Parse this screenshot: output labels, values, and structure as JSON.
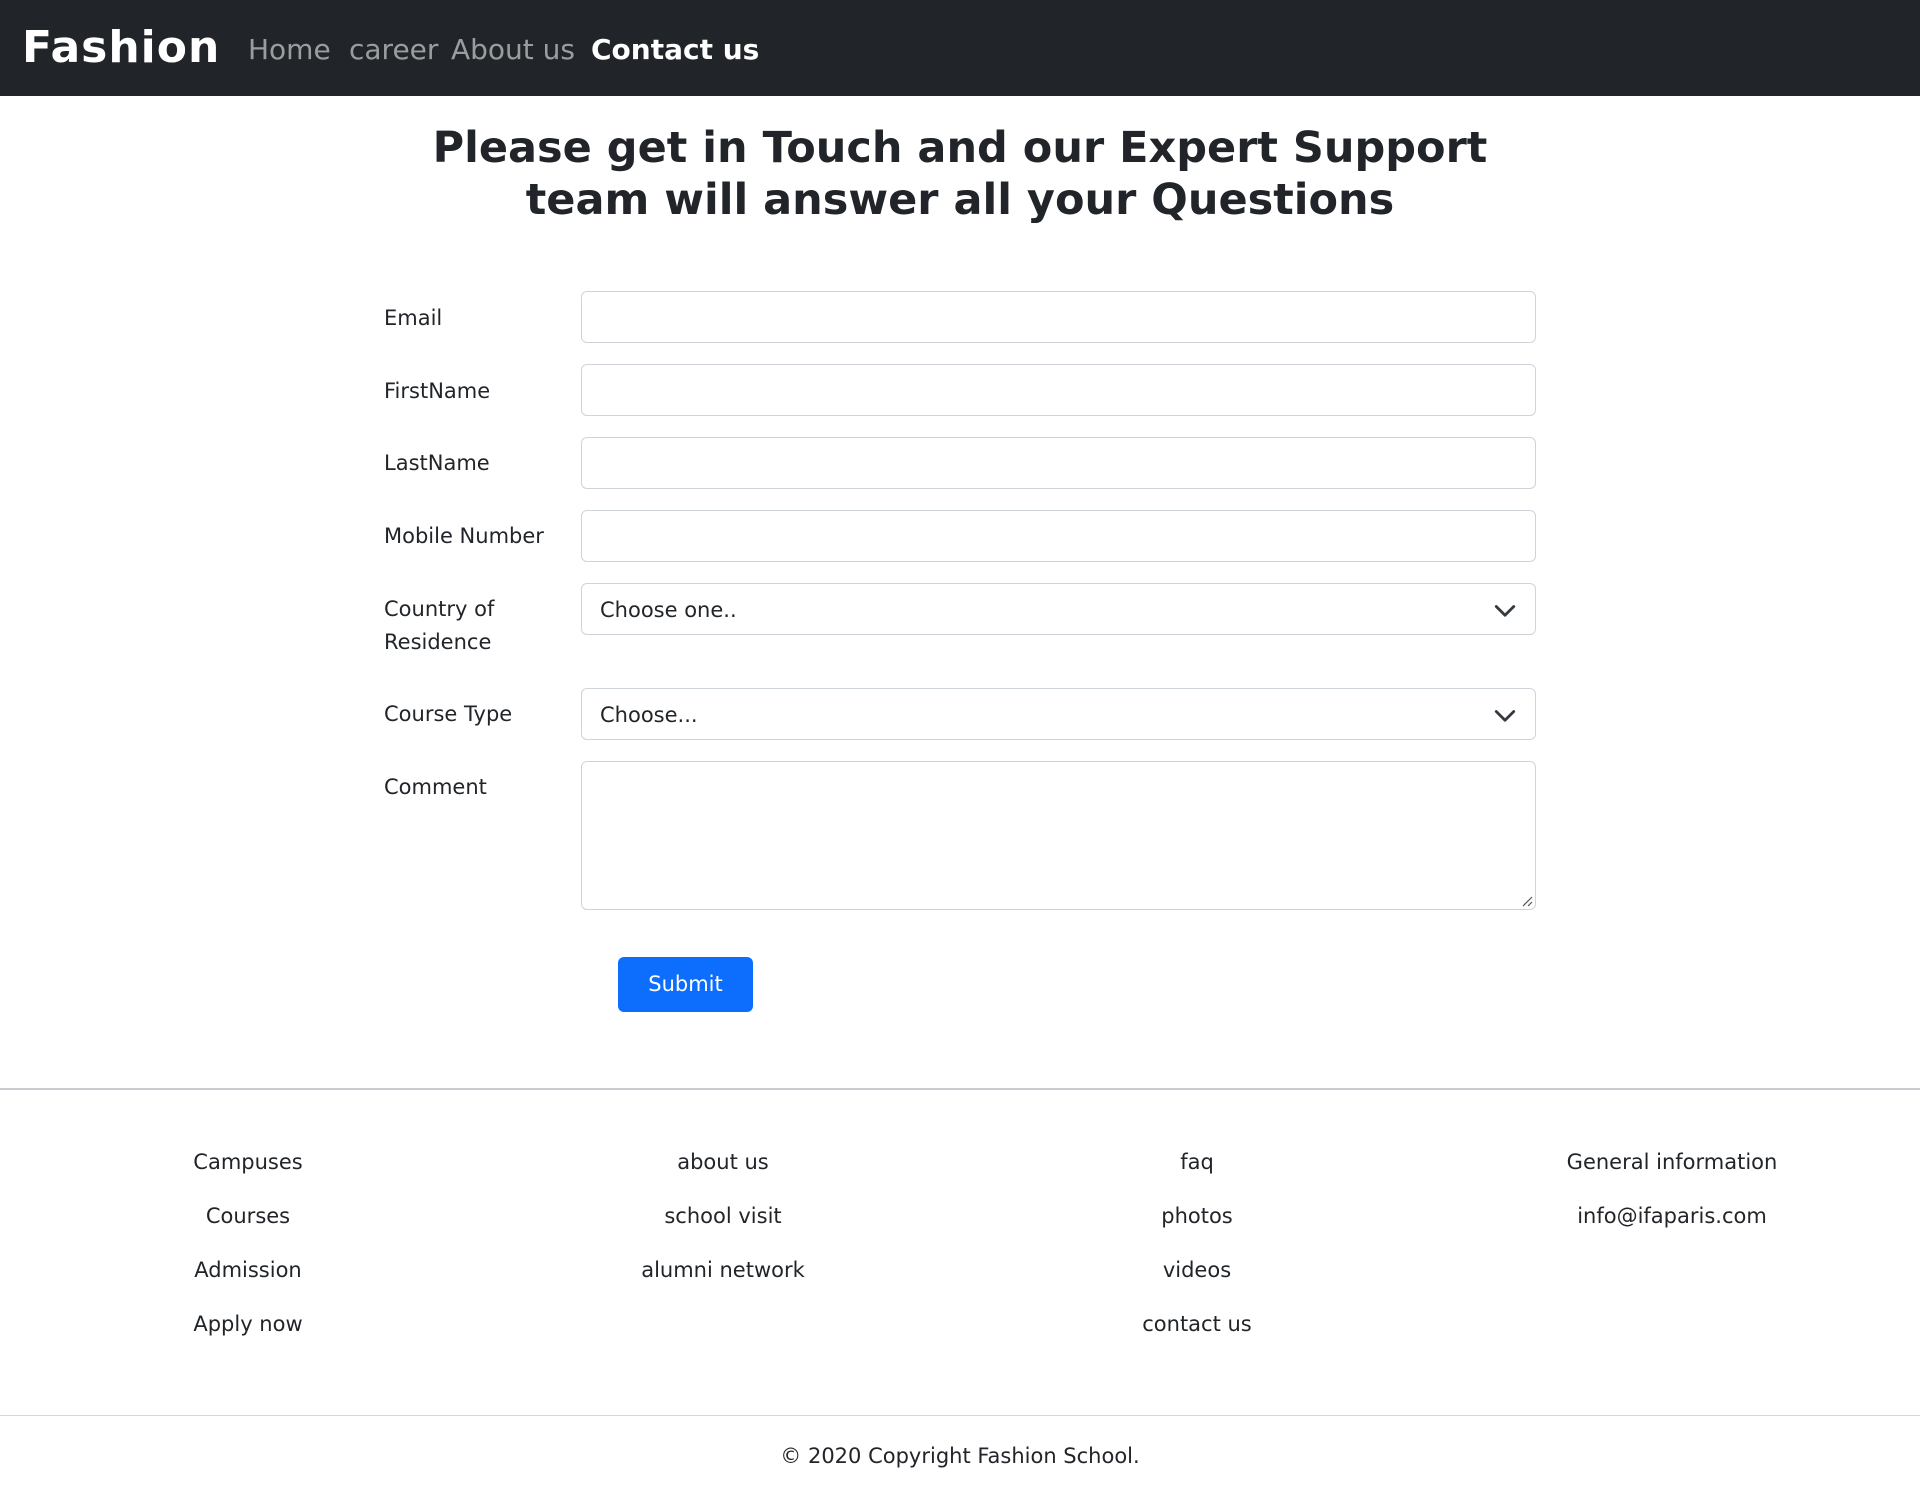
{
  "navbar": {
    "brand": "Fashion",
    "links": [
      "Home",
      "career",
      "About us",
      "Contact us"
    ],
    "active": "Contact us"
  },
  "heading": {
    "line1": "Please get in Touch and our Expert Support",
    "line2": "team will answer all your Questions"
  },
  "form": {
    "email_label": "Email",
    "firstname_label": "FirstName",
    "lastname_label": "LastName",
    "mobile_label": "Mobile Number",
    "country_label_1": "Country of",
    "country_label_2": "Residence",
    "country_value": "Choose one..",
    "course_label": "Course Type",
    "course_value": "Choose...",
    "comment_label": "Comment",
    "submit_label": "Submit"
  },
  "footer": {
    "col1": [
      "Campuses",
      "Courses",
      "Admission",
      "Apply now"
    ],
    "col2": [
      "about us",
      "school visit",
      "alumni network"
    ],
    "col3": [
      "faq",
      "photos",
      "videos",
      "contact us"
    ],
    "col4": [
      "General information",
      "info@ifaparis.com"
    ],
    "copyright": "© 2020 Copyright Fashion School."
  },
  "colors": {
    "navbar_bg": "#212529",
    "primary": "#0d6efd",
    "border": "#ced4da"
  }
}
